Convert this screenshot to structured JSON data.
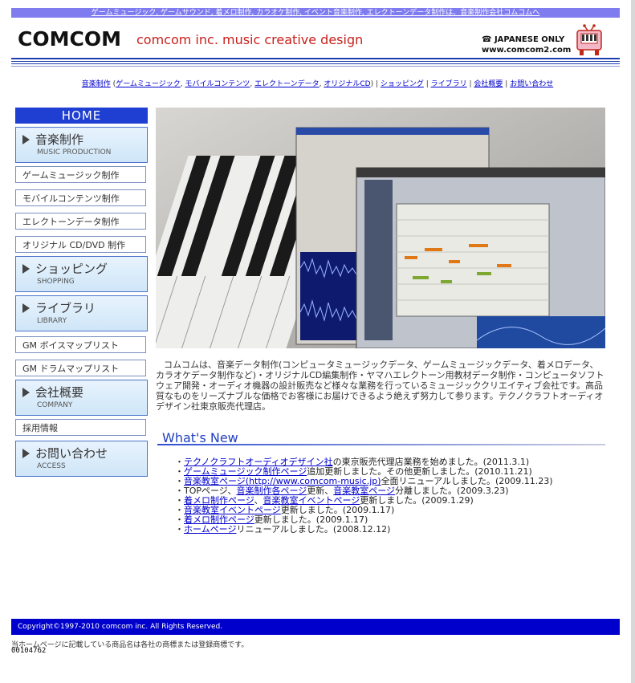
{
  "top_banner": "ゲームミュージック, ゲームサウンド, 着メロ制作, カラオケ制作, イベント音楽制作, エレクトーンデータ制作は、音楽制作会社コムコムへ",
  "logo": "COMCOM",
  "tagline": "comcom inc. music creative design",
  "japanese_only": "JAPANESE ONLY",
  "site_url": "www.comcom2.com",
  "nav_links": {
    "music": "音楽制作",
    "open_paren": " (",
    "game": "ゲームミュージック",
    "mobile": "モバイルコンテンツ",
    "electone": "エレクトーンデータ",
    "original": "オリジナルCD",
    "close_paren": ")",
    "shopping": "ショッピング",
    "library": "ライブラリ",
    "company": "会社概要",
    "contact": "お問い合わせ",
    "sep": " | ",
    "comma": ", "
  },
  "sidebar": {
    "home": "HOME",
    "music_main": "音楽制作",
    "music_sub": "MUSIC PRODUCTION",
    "game": "ゲームミュージック制作",
    "mobile": "モバイルコンテンツ制作",
    "electone": "エレクトーンデータ制作",
    "original": "オリジナル CD/DVD 制作",
    "shopping_main": "ショッピング",
    "shopping_sub": "SHOPPING",
    "library_main": "ライブラリ",
    "library_sub": "LIBRARY",
    "gm_voice": "GM ボイスマップリスト",
    "gm_drum": "GM ドラムマップリスト",
    "company_main": "会社概要",
    "company_sub": "COMPANY",
    "recruit": "採用情報",
    "contact_main": "お問い合わせ",
    "contact_sub": "ACCESS"
  },
  "intro": "コムコムは、音楽データ制作(コンピュータミュージックデータ、ゲームミュージックデータ、着メロデータ、カラオケデータ制作など)・オリジナルCD編集制作・ヤマハエレクトーン用教材データ制作・コンピュータソフトウェア開発・オーディオ機器の設計販売など様々な業務を行っているミュージッククリエイティブ会社です。高品質なものをリーズナブルな価格でお客様にお届けできるよう絶えず努力して参ります。テクノクラフトオーディオデザイン社東京販売代理店。",
  "whats_new": "What's New",
  "news": [
    {
      "link": "テクノクラフトオーディオデザイン社",
      "text": "の東京販売代理店業務を始めました。(2011.3.1)"
    },
    {
      "link": "ゲームミュージック制作ページ",
      "text": "追加更新しました。その他更新しました。(2010.11.21)"
    },
    {
      "link": "音楽教室ページ(http://www.comcom-music.jp)",
      "text": "全面リニューアルしました。(2009.11.23)"
    },
    {
      "pre": "TOPページ、",
      "link": "音楽制作各ページ",
      "mid": "更新、",
      "link2": "音楽教室ページ",
      "text": "分離しました。(2009.3.23)"
    },
    {
      "link": "着メロ制作ページ",
      "mid": "、",
      "link2": "音楽教室イベントページ",
      "text": "更新しました。(2009.1.29)"
    },
    {
      "link": "音楽教室イベントページ",
      "text": "更新しました。(2009.1.17)"
    },
    {
      "link": "着メロ制作ページ",
      "text": "更新しました。(2009.1.17)"
    },
    {
      "link": "ホームページ",
      "text": "リニューアルしました。(2008.12.12)"
    }
  ],
  "footer": "Copyright©1997-2010 comcom inc. All Rights Reserved.",
  "footer_note": "当ホームページに記載している商品名は各社の商標または登録商標です。",
  "counter": "00104762"
}
